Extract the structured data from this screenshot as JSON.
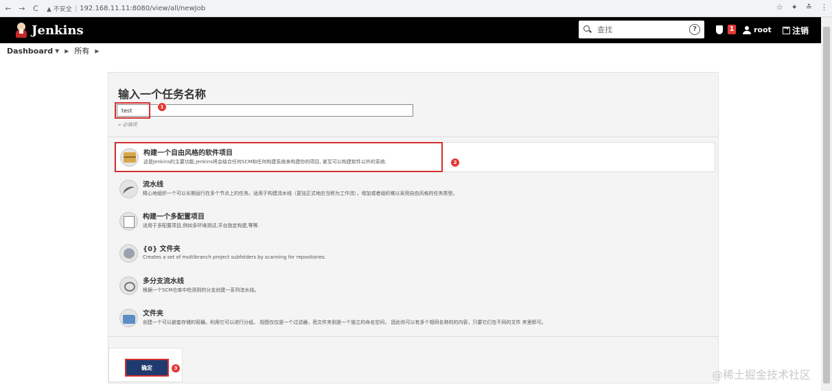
{
  "browser": {
    "nav_back": "←",
    "nav_forward": "→",
    "nav_reload": "C",
    "security_label": "▲ 不安全",
    "separator": "|",
    "url": "192.168.11.11:8080/view/all/newJob",
    "right_icons": [
      "☆",
      "✦",
      "≛",
      "⋮"
    ]
  },
  "header": {
    "brand": "Jenkins",
    "search_placeholder": "查找",
    "help_symbol": "?",
    "alert_count": "1",
    "username": "root",
    "logout_label": "注销"
  },
  "breadcrumb": {
    "items": [
      "Dashboard",
      "所有"
    ]
  },
  "form": {
    "title": "输入一个任务名称",
    "name_value": "test",
    "required_hint": "» 必填项"
  },
  "markers": [
    "1",
    "2",
    "3"
  ],
  "job_types": [
    {
      "icon": "freestyle-box-icon",
      "title": "构建一个自由风格的软件项目",
      "description": "这是Jenkins的主要功能.Jenkins将会结合任何SCM和任何构建系统来构建你的项目, 甚至可以构建软件以外的系统."
    },
    {
      "icon": "pipeline-icon",
      "title": "流水线",
      "description": "精心地组织一个可以长期运行在多个节点上的任务。适用于构建流水线（更加正式地应当称为工作流），增加或者组织难以采用自由风格的任务类型。"
    },
    {
      "icon": "multi-config-icon",
      "title": "构建一个多配置项目",
      "description": "适用于多配置项目,例如多环境测试,平台指定构建,等等."
    },
    {
      "icon": "organization-folder-icon",
      "title": "{0} 文件夹",
      "description": "Creates a set of multibranch project subfolders by scanning for repositories."
    },
    {
      "icon": "multibranch-pipeline-icon",
      "title": "多分支流水线",
      "description": "根据一个SCM仓库中检测到的分支创建一系列流水线。"
    },
    {
      "icon": "folder-icon",
      "title": "文件夹",
      "description": "创建一个可以嵌套存储的容器。利用它可以进行分组。 视图仅仅是一个过滤器，而文件夹则是一个独立的命名空间， 因此你可以有多个相同名称的的内容，只要它们在不同的文件 夹里即可。"
    }
  ],
  "ok_button": "确定",
  "watermark": "@稀土掘金技术社区",
  "colors": {
    "header_bg": "#000000",
    "highlight_red": "#d32f2f",
    "ok_button_bg": "#1f3a6e",
    "badge_red": "#e53935"
  }
}
